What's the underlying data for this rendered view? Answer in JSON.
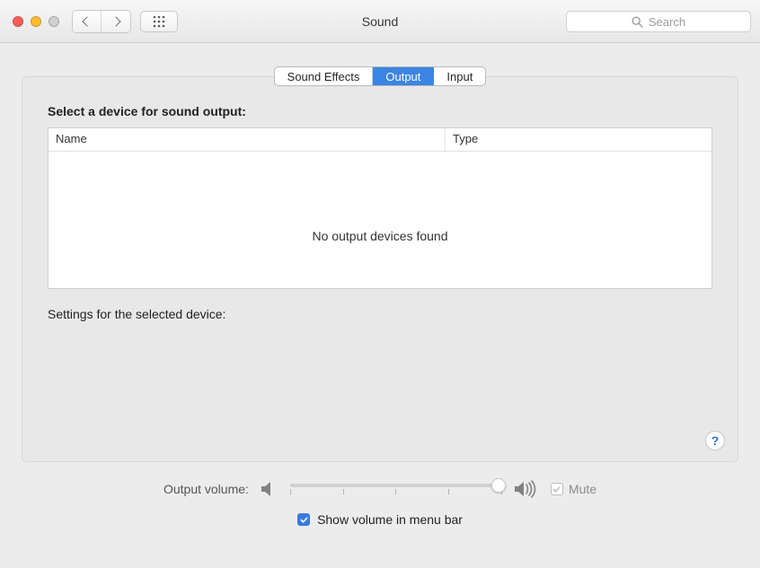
{
  "window": {
    "title": "Sound",
    "search_placeholder": "Search"
  },
  "tabs": [
    {
      "id": "sound-effects",
      "label": "Sound Effects",
      "active": false
    },
    {
      "id": "output",
      "label": "Output",
      "active": true
    },
    {
      "id": "input",
      "label": "Input",
      "active": false
    }
  ],
  "panel": {
    "heading": "Select a device for sound output:",
    "columns": {
      "name": "Name",
      "type": "Type"
    },
    "empty_message": "No output devices found",
    "subheading": "Settings for the selected device:"
  },
  "volume": {
    "label": "Output volume:",
    "value_percent": 100,
    "mute_label": "Mute",
    "mute_checked": false
  },
  "menubar": {
    "show_label": "Show volume in menu bar",
    "checked": true
  }
}
